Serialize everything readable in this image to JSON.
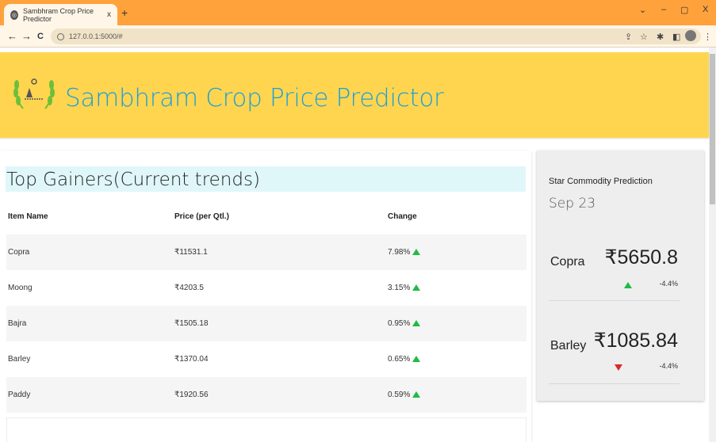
{
  "browser": {
    "tab_title": "Sambhram Crop Price Predictor",
    "tab_close": "x",
    "new_tab": "+",
    "url": "127.0.0.1:5000/#",
    "win_chevron": "⌄",
    "win_min": "–",
    "win_restore": "▢",
    "win_close": "X",
    "back": "←",
    "forward": "→",
    "reload": "C"
  },
  "header": {
    "title": "Sambhram Crop Price Predictor"
  },
  "gainers": {
    "title": "Top Gainers(Current trends)",
    "columns": [
      "Item Name",
      "Price (per Qtl.)",
      "Change"
    ],
    "rows": [
      {
        "name": "Copra",
        "price": "₹11531.1",
        "change": "7.98%"
      },
      {
        "name": "Moong",
        "price": "₹4203.5",
        "change": "3.15%"
      },
      {
        "name": "Bajra",
        "price": "₹1505.18",
        "change": "0.95%"
      },
      {
        "name": "Barley",
        "price": "₹1370.04",
        "change": "0.65%"
      },
      {
        "name": "Paddy",
        "price": "₹1920.56",
        "change": "0.59%"
      }
    ]
  },
  "star": {
    "title": "Star Commodity Prediction",
    "date": "Sep 23",
    "items": [
      {
        "name": "Copra",
        "price": "₹5650.8",
        "change": "-4.4%",
        "direction": "up"
      },
      {
        "name": "Barley",
        "price": "₹1085.84",
        "change": "-4.4%",
        "direction": "down"
      }
    ]
  },
  "colors": {
    "header_bg": "#ffd54f",
    "title_blue": "#1e9fd6",
    "up_green": "#21ba45",
    "down_red": "#db2828"
  }
}
